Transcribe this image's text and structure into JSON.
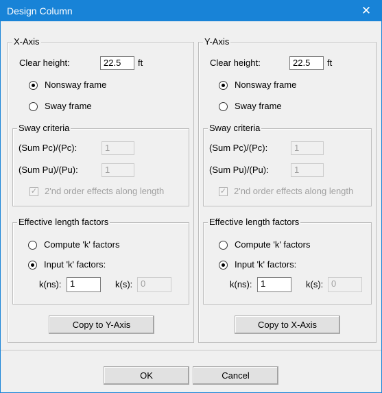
{
  "window": {
    "title": "Design Column",
    "close_glyph": "✕"
  },
  "x_axis": {
    "legend": "X-Axis",
    "clear_height_label": "Clear height:",
    "clear_height_value": "22.5",
    "clear_height_unit": "ft",
    "nonsway_label": "Nonsway frame",
    "sway_label": "Sway frame",
    "sway_criteria": {
      "legend": "Sway criteria",
      "pc_label": "(Sum Pc)/(Pc):",
      "pc_value": "1",
      "pu_label": "(Sum Pu)/(Pu):",
      "pu_value": "1",
      "second_order_label": "2'nd order effects along length"
    },
    "effective_length": {
      "legend": "Effective length factors",
      "compute_label": "Compute 'k' factors",
      "input_label": "Input 'k' factors:",
      "kns_label": "k(ns):",
      "kns_value": "1",
      "ks_label": "k(s):",
      "ks_value": "0"
    },
    "copy_button": "Copy to Y-Axis"
  },
  "y_axis": {
    "legend": "Y-Axis",
    "clear_height_label": "Clear height:",
    "clear_height_value": "22.5",
    "clear_height_unit": "ft",
    "nonsway_label": "Nonsway frame",
    "sway_label": "Sway frame",
    "sway_criteria": {
      "legend": "Sway criteria",
      "pc_label": "(Sum Pc)/(Pc):",
      "pc_value": "1",
      "pu_label": "(Sum Pu)/(Pu):",
      "pu_value": "1",
      "second_order_label": "2'nd order effects along length"
    },
    "effective_length": {
      "legend": "Effective length factors",
      "compute_label": "Compute 'k' factors",
      "input_label": "Input 'k' factors:",
      "kns_label": "k(ns):",
      "kns_value": "1",
      "ks_label": "k(s):",
      "ks_value": "0"
    },
    "copy_button": "Copy to X-Axis"
  },
  "footer": {
    "ok_label": "OK",
    "cancel_label": "Cancel"
  }
}
